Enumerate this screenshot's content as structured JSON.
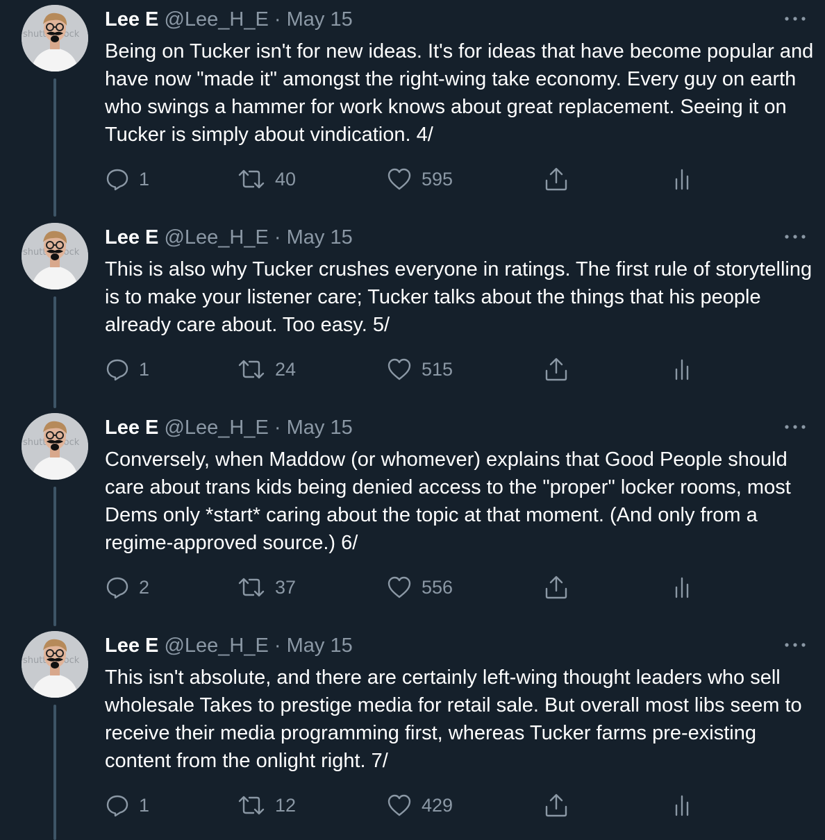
{
  "tweets": [
    {
      "name": "Lee E",
      "handle": "@Lee_H_E",
      "separator": "·",
      "date": "May 15",
      "text": "Being on Tucker isn't for new ideas. It's for ideas that have become popular and have now \"made it\" amongst the right-wing take economy. Every guy on earth who swings a hammer for work knows about great replacement. Seeing it on Tucker is simply about vindication. 4/",
      "replies": "1",
      "retweets": "40",
      "likes": "595"
    },
    {
      "name": "Lee E",
      "handle": "@Lee_H_E",
      "separator": "·",
      "date": "May 15",
      "text": "This is also why Tucker crushes everyone in ratings. The first rule of storytelling is to make your listener care; Tucker talks about the things that his people already care about. Too easy. 5/",
      "replies": "1",
      "retweets": "24",
      "likes": "515"
    },
    {
      "name": "Lee E",
      "handle": "@Lee_H_E",
      "separator": "·",
      "date": "May 15",
      "text": "Conversely, when Maddow (or whomever) explains that Good People should care about trans kids being denied access to the \"proper\" locker rooms, most Dems only *start* caring about the topic at that moment. (And only from a regime-approved source.) 6/",
      "replies": "2",
      "retweets": "37",
      "likes": "556"
    },
    {
      "name": "Lee E",
      "handle": "@Lee_H_E",
      "separator": "·",
      "date": "May 15",
      "text": "This isn't absolute, and there are certainly left-wing thought leaders who sell wholesale Takes to prestige media for retail sale. But overall most libs seem to receive their media programming first, whereas Tucker farms pre-existing content from the onlight right. 7/",
      "replies": "1",
      "retweets": "12",
      "likes": "429"
    }
  ],
  "avatar_watermark": "shutterstock",
  "icons": {
    "avatar": "avatar-photo",
    "more": "more-dots-icon",
    "reply": "reply-icon",
    "retweet": "retweet-icon",
    "like": "heart-icon",
    "share": "share-icon",
    "analytics": "analytics-icon"
  },
  "colors": {
    "background": "#15202b",
    "text": "#ffffff",
    "muted": "#8b98a5",
    "thread_line": "#3d5466"
  }
}
